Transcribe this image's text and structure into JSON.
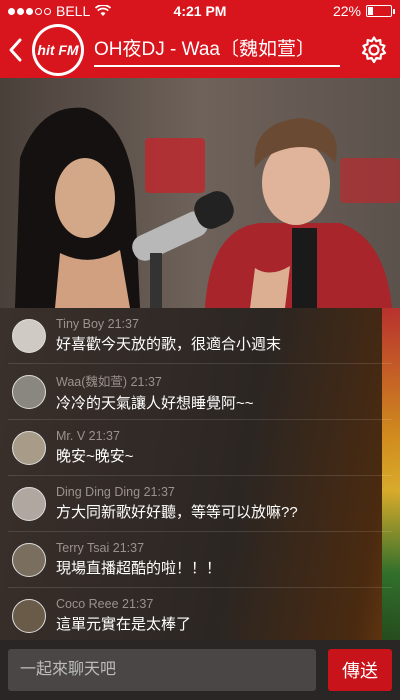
{
  "status_bar": {
    "carrier": "BELL",
    "time": "4:21 PM",
    "battery": "22%",
    "battery_level": 0.22
  },
  "header": {
    "logo_text": "hit FM",
    "title": "OH夜DJ - Waa〔魏如萱〕"
  },
  "chat": {
    "messages": [
      {
        "user": "Tiny Boy",
        "time": "21:37",
        "text": "好喜歡今天放的歌，很適合小週末",
        "avatar_color": "#cfcac4"
      },
      {
        "user": "Waa(魏如萱)",
        "time": "21:37",
        "text": "冷冷的天氣讓人好想睡覺阿~~",
        "avatar_color": "#8a8680"
      },
      {
        "user": "Mr. V",
        "time": "21:37",
        "text": "晚安~晚安~",
        "avatar_color": "#a89c88"
      },
      {
        "user": "Ding Ding Ding",
        "time": "21:37",
        "text": "方大同新歌好好聽，等等可以放嘛??",
        "avatar_color": "#b0a8a0"
      },
      {
        "user": "Terry Tsai",
        "time": "21:37",
        "text": "現場直播超酷的啦！！！",
        "avatar_color": "#7a6e5e"
      },
      {
        "user": "Coco Reee",
        "time": "21:37",
        "text": "這單元實在是太棒了",
        "avatar_color": "#6a5a48"
      }
    ]
  },
  "input": {
    "placeholder": "一起來聊天吧",
    "send_label": "傳送"
  },
  "colors": {
    "brand": "#d8141c",
    "send": "#c8131a"
  }
}
